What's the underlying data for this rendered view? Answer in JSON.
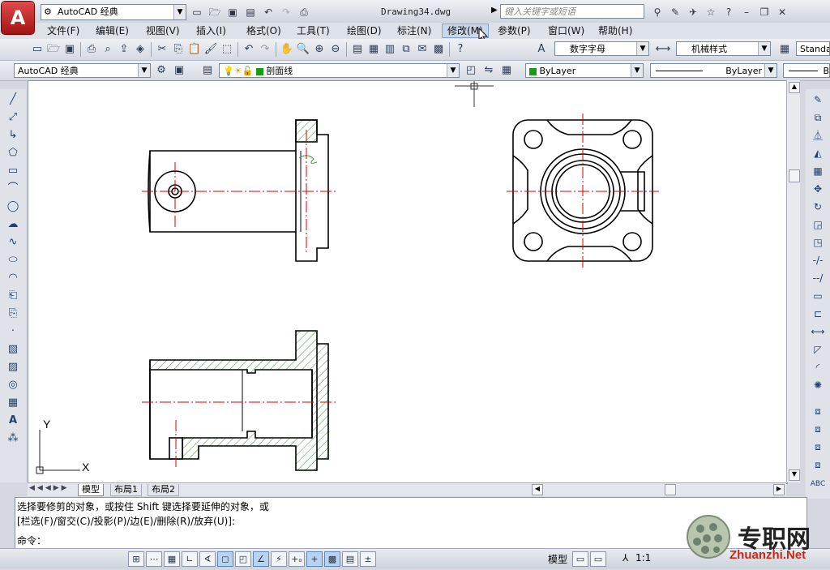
{
  "app": {
    "logo_letter": "A"
  },
  "workspace": {
    "name": "AutoCAD 经典"
  },
  "document": {
    "title": "Drawing34.dwg"
  },
  "search": {
    "placeholder": "键入关键字或短语"
  },
  "menu": {
    "items": [
      "文件(F)",
      "编辑(E)",
      "视图(V)",
      "插入(I)",
      "格式(O)",
      "工具(T)",
      "绘图(D)",
      "标注(N)",
      "修改(M)",
      "参数(P)",
      "窗口(W)",
      "帮助(H)"
    ],
    "active_index": 8
  },
  "styles": {
    "text_style": "数字字母",
    "dim_style": "机械样式",
    "table_style": "Standa"
  },
  "layers": {
    "workspace_combo": "AutoCAD 经典",
    "current_layer": "剖面线",
    "color": "ByLayer",
    "linetype": "ByLayer",
    "lineweight": "B"
  },
  "tabs": {
    "items": [
      "模型",
      "布局1",
      "布局2"
    ],
    "active": "模型"
  },
  "ucs": {
    "x": "X",
    "y": "Y"
  },
  "command": {
    "line1": "选择要修剪的对象，或按住 Shift 键选择要延伸的对象，或",
    "line2": "[栏选(F)/窗交(C)/投影(P)/边(E)/删除(R)/放弃(U)]:",
    "prompt": "命令："
  },
  "status": {
    "model_label": "模型",
    "scale": "1:1"
  },
  "watermark": {
    "brand": "专职网",
    "site": "Zhuanzhi.Net"
  },
  "colors": {
    "hatch": "#3a9a3a",
    "centerline": "#d40000",
    "accent": "#b81c1c"
  }
}
